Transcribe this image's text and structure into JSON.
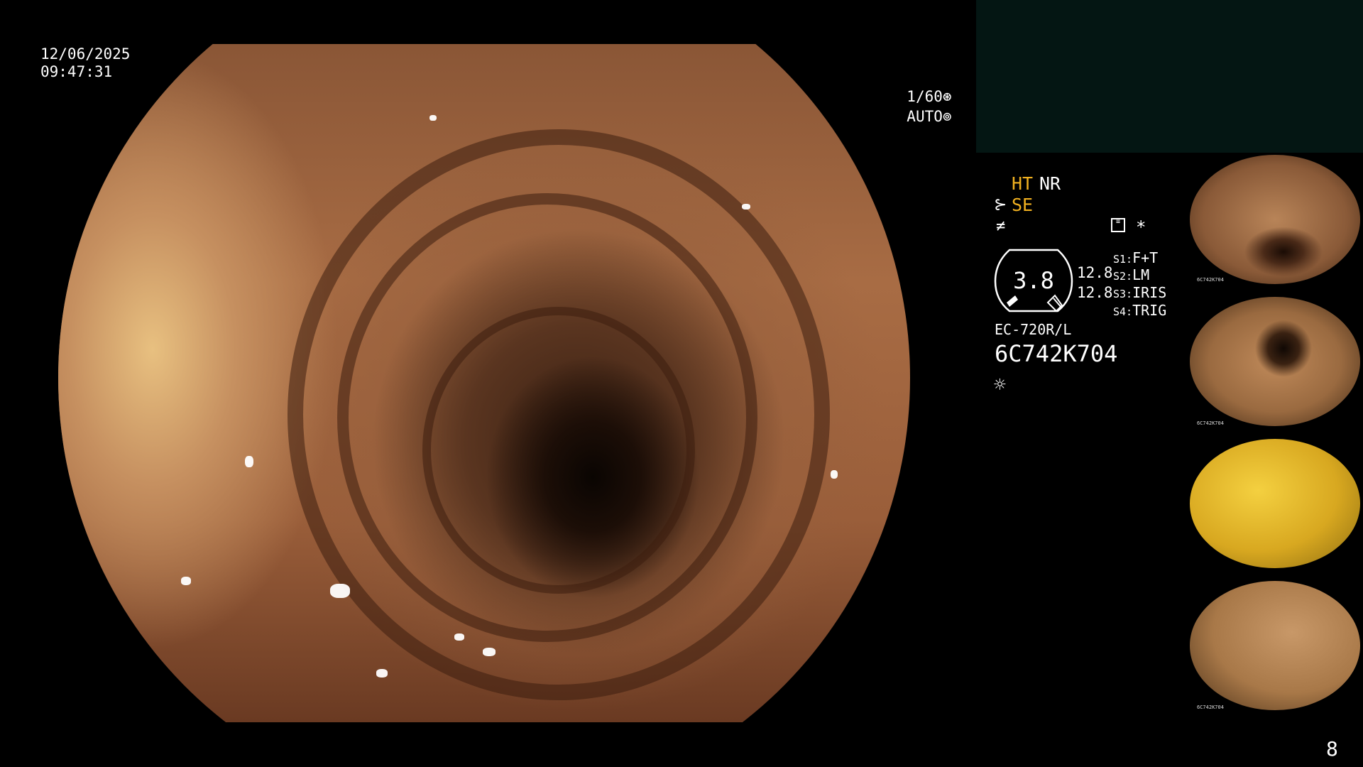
{
  "overlay": {
    "date": "12/06/2025",
    "time": "09:47:31",
    "shutter": "1/60",
    "mode": "AUTO"
  },
  "side": {
    "ht": "HT",
    "nr": "NR",
    "se": "SE",
    "gauge_value": "3.8",
    "val1": "12.8",
    "val2": "12.8",
    "s1_key": "S1:",
    "s1_val": "F+T",
    "s2_key": "S2:",
    "s2_val": "LM",
    "s3_key": "S3:",
    "s3_val": "IRIS",
    "s4_key": "S4:",
    "s4_val": "TRIG",
    "scope_model": "EC-720R/L",
    "serial": "6C742K704",
    "asterisk": "*"
  },
  "thumbnails": [
    {
      "serial": "6C742K704"
    },
    {
      "serial": "6C742K704"
    },
    {
      "serial": ""
    },
    {
      "serial": "6C742K704"
    }
  ],
  "page_number": "8",
  "colors": {
    "accent_yellow": "#f0b020",
    "panel_dark": "#041613"
  },
  "icons": [
    "shutter-icon",
    "auto-iris-icon",
    "scope-tool-icon",
    "zoom-icon",
    "memo-icon",
    "light-icon"
  ]
}
